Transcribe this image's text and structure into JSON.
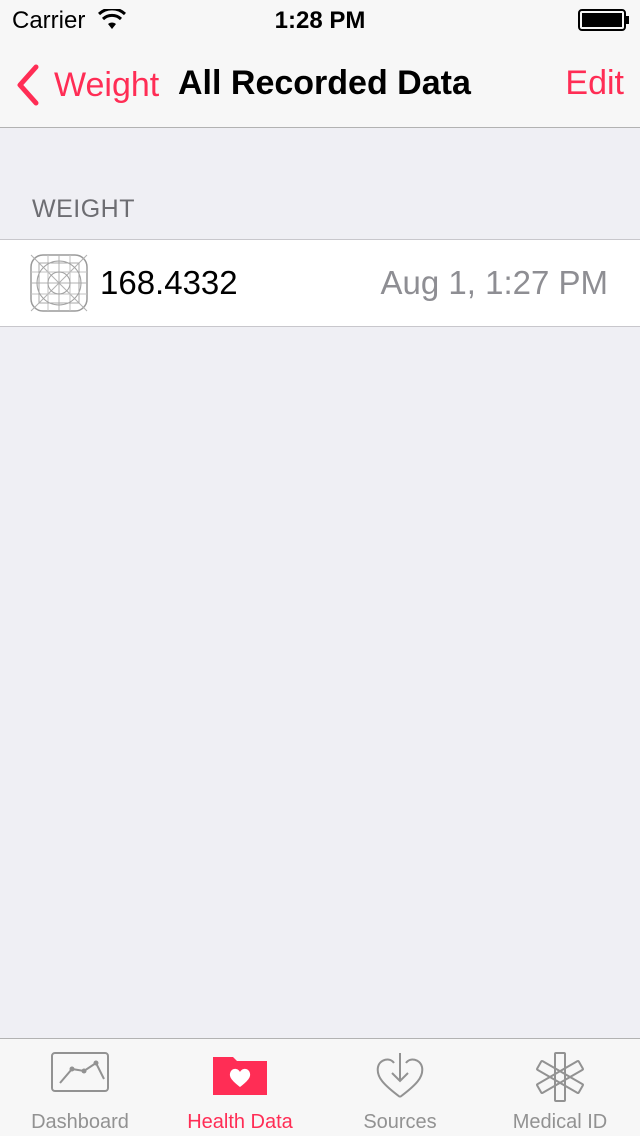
{
  "status_bar": {
    "carrier": "Carrier",
    "time": "1:28 PM"
  },
  "nav": {
    "back_label": "Weight",
    "title": "All Recorded Data",
    "edit_label": "Edit"
  },
  "section": {
    "header": "WEIGHT"
  },
  "rows": [
    {
      "value": "168.4332",
      "date": "Aug 1, 1:27 PM",
      "icon": "app-placeholder-icon"
    }
  ],
  "tab_bar": {
    "tabs": [
      {
        "label": "Dashboard",
        "icon": "dashboard-chart-icon",
        "active": false
      },
      {
        "label": "Health Data",
        "icon": "health-folder-icon",
        "active": true
      },
      {
        "label": "Sources",
        "icon": "sources-heart-download-icon",
        "active": false
      },
      {
        "label": "Medical ID",
        "icon": "medical-star-icon",
        "active": false
      }
    ]
  },
  "colors": {
    "accent": "#ff2d55",
    "background": "#efeff4",
    "secondary_text": "#8e8e93",
    "tab_inactive": "#929292"
  }
}
